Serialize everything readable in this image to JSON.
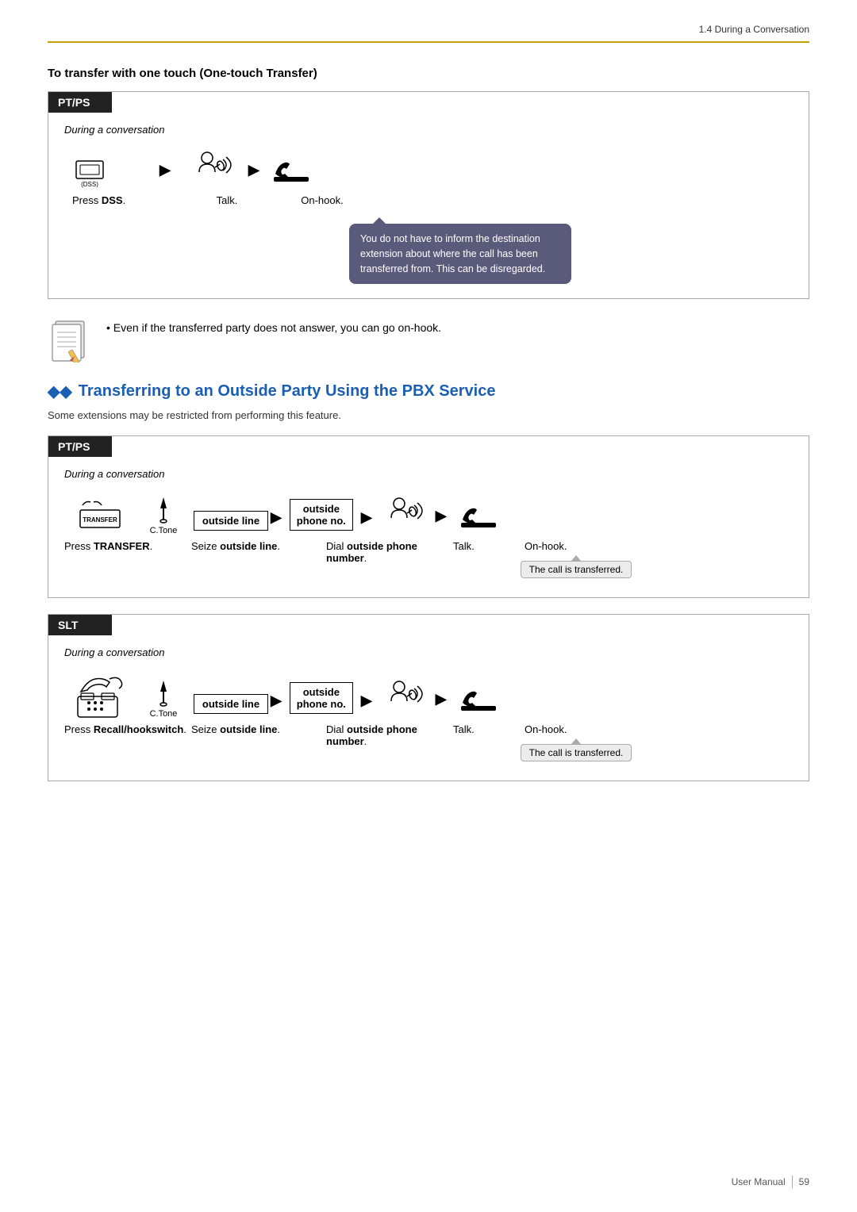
{
  "header": {
    "title": "1.4 During a Conversation"
  },
  "section1": {
    "heading": "To transfer with one touch (One-touch Transfer)",
    "box_label": "PT/PS",
    "during_label": "During a conversation",
    "steps": [
      {
        "label": "Press ",
        "bold": "DSS",
        "label_suffix": "."
      },
      {
        "label": "Talk."
      },
      {
        "label": "On-hook."
      }
    ],
    "bubble_text": "You do not have to inform the destination extension about where the call has been transferred from. This can be disregarded."
  },
  "note": {
    "bullet": "Even if the transferred party does not answer, you can go on-hook."
  },
  "section2": {
    "diamonds": "◆◆",
    "title": "Transferring to an Outside Party Using the PBX Service",
    "subtitle": "Some extensions may be restricted from performing this feature.",
    "box1": {
      "label": "PT/PS",
      "during_label": "During a conversation",
      "steps_icons": [
        "transfer_btn",
        "ctone",
        "outside_line_btn",
        "arrow",
        "outside_phone_no_btn",
        "arrow",
        "talk_icon",
        "arrow",
        "onhook_icon"
      ],
      "step_labels": [
        {
          "text": "Press ",
          "bold": "TRANSFER",
          "suffix": "."
        },
        {
          "text": "Seize ",
          "bold": "outside line",
          "suffix": "."
        },
        {
          "text": "Dial ",
          "bold": "outside phone",
          "bold2": "number",
          "suffix": "."
        },
        {
          "text": "Talk."
        },
        {
          "text": "On-hook."
        }
      ],
      "transfer_note": "The call is transferred."
    },
    "box2": {
      "label": "SLT",
      "during_label": "During a conversation",
      "steps_icons": [
        "recall_btn",
        "ctone",
        "outside_line_btn",
        "arrow",
        "outside_phone_no_btn",
        "arrow",
        "talk_icon",
        "arrow",
        "onhook_icon"
      ],
      "step_labels": [
        {
          "text": "Press ",
          "bold": "Recall/hookswitch",
          "suffix": "."
        },
        {
          "text": "Seize ",
          "bold": "outside line",
          "suffix": "."
        },
        {
          "text": "Dial ",
          "bold": "outside phone",
          "bold2": "number",
          "suffix": "."
        },
        {
          "text": "Talk."
        },
        {
          "text": "On-hook."
        }
      ],
      "transfer_note": "The call is transferred."
    }
  },
  "footer": {
    "label": "User Manual",
    "page": "59"
  }
}
